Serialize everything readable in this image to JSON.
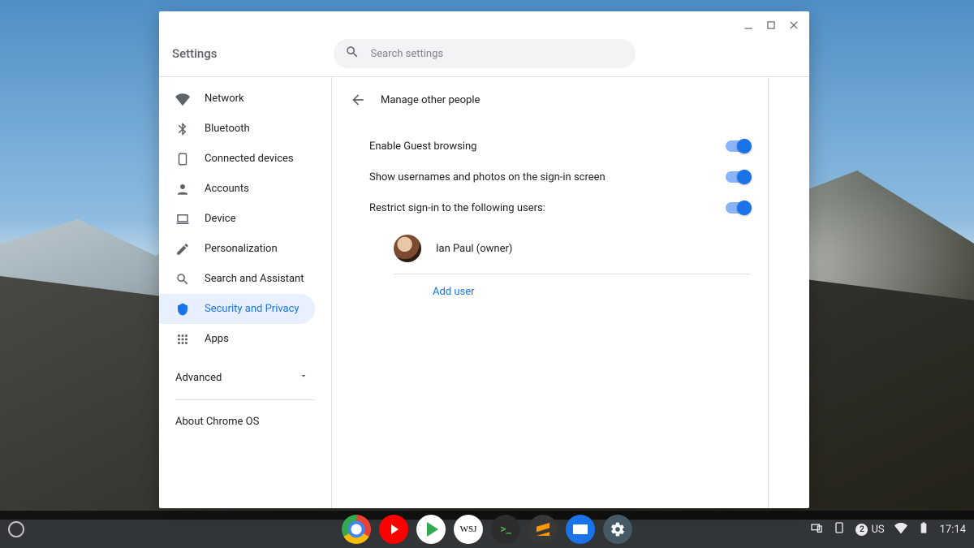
{
  "window": {
    "title": "Settings",
    "search_placeholder": "Search settings"
  },
  "sidebar": {
    "items": [
      {
        "icon": "wifi",
        "label": "Network"
      },
      {
        "icon": "bluetooth",
        "label": "Bluetooth"
      },
      {
        "icon": "devices",
        "label": "Connected devices"
      },
      {
        "icon": "account",
        "label": "Accounts"
      },
      {
        "icon": "laptop",
        "label": "Device"
      },
      {
        "icon": "pen",
        "label": "Personalization"
      },
      {
        "icon": "search",
        "label": "Search and Assistant"
      },
      {
        "icon": "shield",
        "label": "Security and Privacy"
      },
      {
        "icon": "apps",
        "label": "Apps"
      }
    ],
    "advanced_label": "Advanced",
    "about_label": "About Chrome OS"
  },
  "page": {
    "title": "Manage other people",
    "rows": [
      {
        "label": "Enable Guest browsing",
        "on": true
      },
      {
        "label": "Show usernames and photos on the sign-in screen",
        "on": true
      },
      {
        "label": "Restrict sign-in to the following users:",
        "on": true
      }
    ],
    "user": {
      "name": "Ian Paul (owner)"
    },
    "add_user_label": "Add user"
  },
  "shelf": {
    "apps": [
      {
        "id": "chrome",
        "name": "Chrome"
      },
      {
        "id": "youtube",
        "name": "YouTube"
      },
      {
        "id": "play",
        "name": "Play Store"
      },
      {
        "id": "wsj",
        "name": "WSJ",
        "text": "WSJ"
      },
      {
        "id": "term",
        "name": "Terminal"
      },
      {
        "id": "subl",
        "name": "Sublime"
      },
      {
        "id": "files",
        "name": "Files"
      },
      {
        "id": "sett",
        "name": "Settings"
      }
    ],
    "tray": {
      "notif_count": "2",
      "ime": "US",
      "time": "17:14"
    }
  }
}
